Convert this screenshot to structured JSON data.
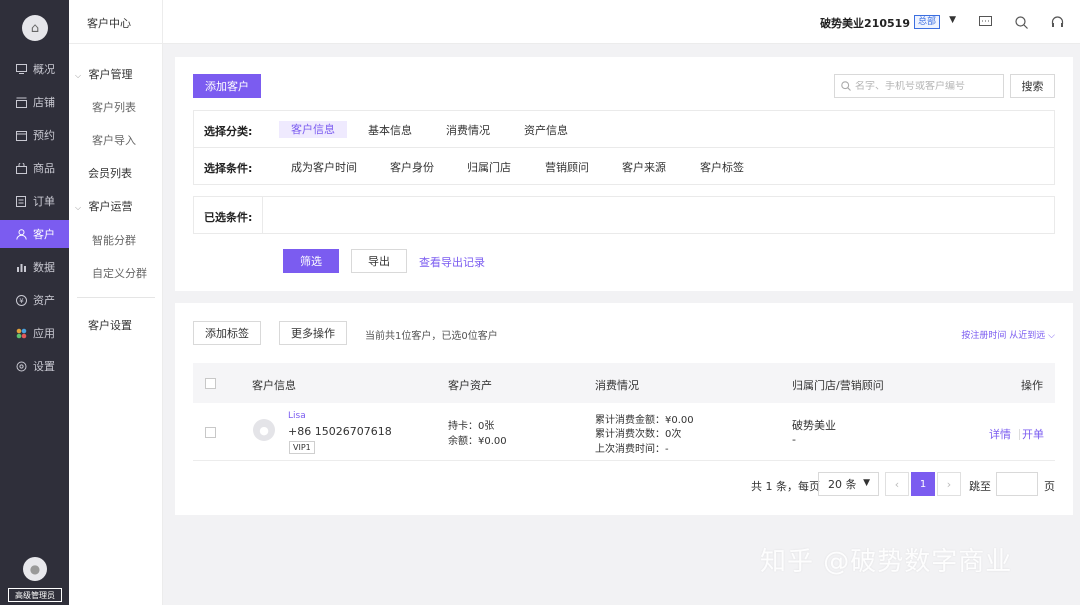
{
  "nav": {
    "items": [
      {
        "key": "overview",
        "label": "概况",
        "icon": "monitor-icon"
      },
      {
        "key": "store",
        "label": "店铺",
        "icon": "store-icon"
      },
      {
        "key": "booking",
        "label": "预约",
        "icon": "calendar-icon"
      },
      {
        "key": "goods",
        "label": "商品",
        "icon": "bag-icon"
      },
      {
        "key": "orders",
        "label": "订单",
        "icon": "list-icon"
      },
      {
        "key": "customers",
        "label": "客户",
        "icon": "user-icon",
        "active": true
      },
      {
        "key": "data",
        "label": "数据",
        "icon": "chart-icon"
      },
      {
        "key": "assets",
        "label": "资产",
        "icon": "coin-icon"
      },
      {
        "key": "apps",
        "label": "应用",
        "icon": "grid-icon"
      },
      {
        "key": "settings",
        "label": "设置",
        "icon": "gear-icon"
      }
    ],
    "role": "高级管理员",
    "accent": "#7b5cf0"
  },
  "subnav": {
    "title": "客户中心",
    "customer_mgmt": "客户管理",
    "customer_list": "客户列表",
    "customer_import": "客户导入",
    "member_list": "会员列表",
    "customer_ops": "客户运营",
    "smart_group": "智能分群",
    "custom_group": "自定义分群",
    "customer_settings": "客户设置"
  },
  "header": {
    "store_name": "破势美业210519",
    "store_badge": "总部"
  },
  "filters": {
    "add_customer": "添加客户",
    "search_placeholder": "名字、手机号或客户编号",
    "search_button": "搜索",
    "category_label": "选择分类:",
    "categories": [
      "客户信息",
      "基本信息",
      "消费情况",
      "资产信息"
    ],
    "condition_label": "选择条件:",
    "conditions": [
      "成为客户时间",
      "客户身份",
      "归属门店",
      "营销顾问",
      "客户来源",
      "客户标签"
    ],
    "chosen_label": "已选条件:",
    "filter_button": "筛选",
    "export_button": "导出",
    "export_records": "查看导出记录"
  },
  "list": {
    "add_tag": "添加标签",
    "more_ops": "更多操作",
    "summary": "当前共1位客户，已选0位客户",
    "sort": "按注册时间 从近到远",
    "columns": [
      "客户信息",
      "客户资产",
      "消费情况",
      "归属门店/营销顾问",
      "操作"
    ],
    "rows": [
      {
        "name": "Lisa",
        "phone": "+86 15026707618",
        "level": "VIP1",
        "cards": "持卡：0张",
        "balance": "余额：¥0.00",
        "total_amount": "累计消费金额：¥0.00",
        "total_count": "累计消费次数：0次",
        "last_time": "上次消费时间：-",
        "store": "破势美业",
        "advisor": "-",
        "op_detail": "详情",
        "op_card": "开单"
      }
    ]
  },
  "pager": {
    "total_text": "共 1 条，每页",
    "page_size": "20 条",
    "current_page": "1",
    "jump_label": "跳至",
    "page_unit": "页"
  },
  "watermark": "知乎 @破势数字商业"
}
